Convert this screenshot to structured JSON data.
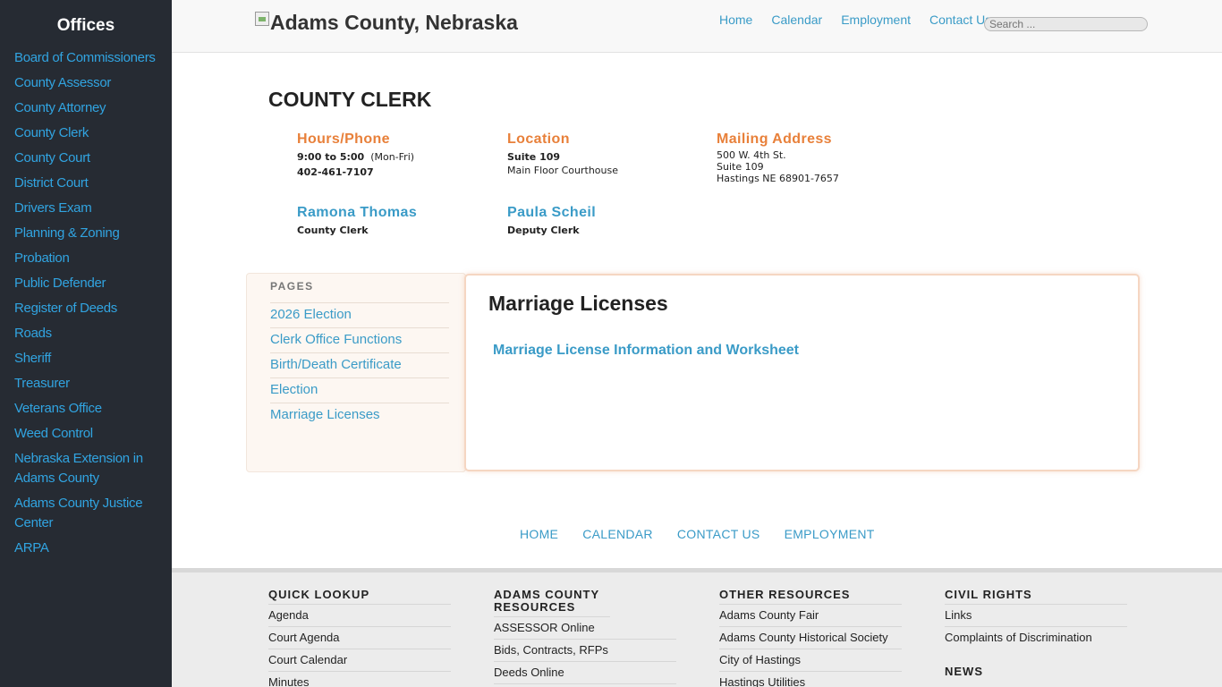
{
  "sidebar": {
    "title": "Offices",
    "items": [
      "Board of Commissioners",
      "County Assessor",
      "County Attorney",
      "County Clerk",
      "County Court",
      "District Court",
      "Drivers Exam",
      "Planning & Zoning",
      "Probation",
      "Public Defender",
      "Register of Deeds",
      "Roads",
      "Sheriff",
      "Treasurer",
      "Veterans Office",
      "Weed Control",
      "Nebraska Extension in Adams County",
      "Adams County Justice Center",
      "ARPA"
    ]
  },
  "header": {
    "site_title": "Adams County, Nebraska",
    "nav": [
      "Home",
      "Calendar",
      "Employment",
      "Contact Us"
    ],
    "search_placeholder": "Search ..."
  },
  "department": {
    "title": "COUNTY CLERK",
    "hours": {
      "heading": "Hours/Phone",
      "time": "9:00 to 5:00",
      "days": "(Mon-Fri)",
      "phone": "402-461-7107"
    },
    "location": {
      "heading": "Location",
      "suite": "Suite 109",
      "detail": "Main Floor Courthouse"
    },
    "mailing": {
      "heading": "Mailing Address",
      "line1": "500 W. 4th St.",
      "line2": "Suite 109",
      "line3": "Hastings NE 68901-7657"
    },
    "staff": [
      {
        "name": "Ramona Thomas",
        "role": "County Clerk"
      },
      {
        "name": "Paula Scheil",
        "role": "Deputy Clerk"
      }
    ]
  },
  "pages": {
    "heading": "PAGES",
    "items": [
      "2026 Election",
      "Clerk Office Functions",
      "Birth/Death Certificate",
      "Election",
      "Marriage Licenses"
    ]
  },
  "main": {
    "heading": "Marriage Licenses",
    "link": "Marriage License Information and Worksheet"
  },
  "footer_nav": [
    "HOME",
    "CALENDAR",
    "CONTACT US",
    "EMPLOYMENT"
  ],
  "footer": {
    "quick_lookup": {
      "title": "QUICK LOOKUP",
      "items": [
        "Agenda",
        "Court Agenda",
        "Court Calendar",
        "Minutes"
      ]
    },
    "resources": {
      "title": "ADAMS COUNTY RESOURCES",
      "items": [
        "ASSESSOR Online",
        "Bids, Contracts, RFPs",
        "Deeds Online"
      ]
    },
    "other": {
      "title": "OTHER RESOURCES",
      "items": [
        "Adams County Fair",
        "Adams County Historical Society",
        "City of Hastings",
        "Hastings Utilities"
      ]
    },
    "civil_rights": {
      "title": "CIVIL RIGHTS",
      "items": [
        "Links",
        "Complaints of Discrimination"
      ]
    },
    "news": {
      "title": "NEWS"
    }
  }
}
